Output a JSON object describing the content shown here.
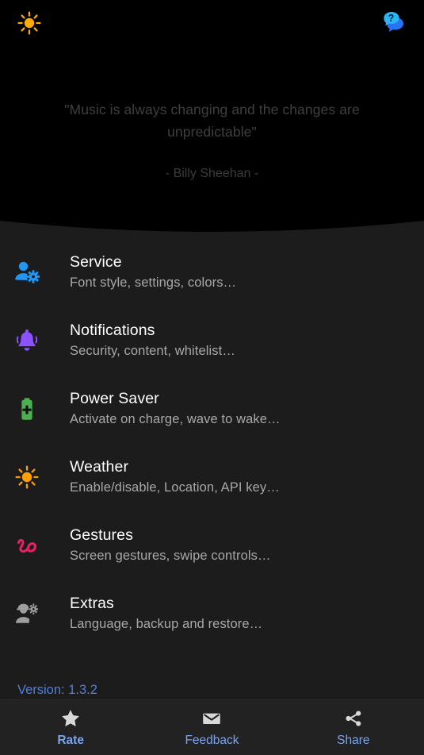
{
  "colors": {
    "background": "#000000",
    "panel": "#1c1c1c",
    "bottom_bar": "#222222",
    "title_text": "#ffffff",
    "subtitle_text": "#a8a8a8",
    "quote_text": "#3f3f3f",
    "accent_blue": "#7ba4ef",
    "version_blue": "#4d7fe0",
    "icon_service": "#2196f3",
    "icon_notifications": "#8c52ff",
    "icon_power": "#4caf50",
    "icon_weather": "#ffa000",
    "icon_gestures": "#e91e63",
    "icon_extras": "#9e9e9e",
    "icon_help": "#29b6f6",
    "icon_sun": "#ffa000"
  },
  "topbar": {
    "theme_toggle_icon": "sun-icon",
    "help_icon": "help-chat-icon"
  },
  "hero": {
    "quote": "\"Music is always changing and the changes are unpredictable\"",
    "author": "- Billy Sheehan -"
  },
  "settings": {
    "items": [
      {
        "icon": "person-settings-icon",
        "title": "Service",
        "subtitle": "Font style, settings, colors…"
      },
      {
        "icon": "bell-icon",
        "title": "Notifications",
        "subtitle": "Security, content, whitelist…"
      },
      {
        "icon": "battery-plus-icon",
        "title": "Power Saver",
        "subtitle": "Activate on charge, wave to wake…"
      },
      {
        "icon": "sun-icon",
        "title": "Weather",
        "subtitle": "Enable/disable, Location, API key…"
      },
      {
        "icon": "gesture-swipe-icon",
        "title": "Gestures",
        "subtitle": "Screen gestures, swipe controls…"
      },
      {
        "icon": "engineer-gear-icon",
        "title": "Extras",
        "subtitle": "Language, backup and restore…"
      }
    ]
  },
  "footer": {
    "version": "Version: 1.3.2"
  },
  "bottom_nav": {
    "items": [
      {
        "icon": "star-icon",
        "label": "Rate",
        "active": true
      },
      {
        "icon": "envelope-icon",
        "label": "Feedback",
        "active": false
      },
      {
        "icon": "share-icon",
        "label": "Share",
        "active": false
      }
    ]
  }
}
